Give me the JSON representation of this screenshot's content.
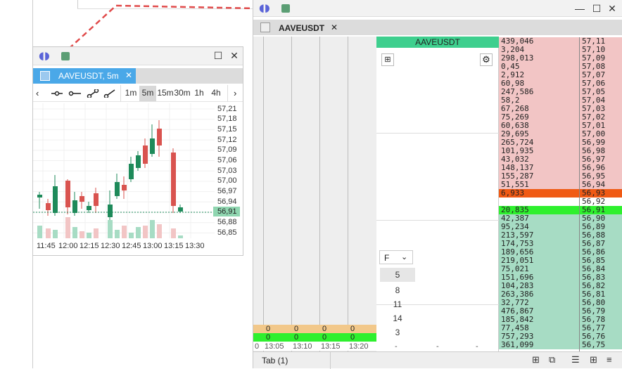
{
  "left_window": {
    "tab_title": "AAVEUSDT, 5m",
    "timeframes": [
      "1m",
      "5m",
      "15m",
      "30m",
      "1h",
      "4h"
    ],
    "selected_timeframe": "5m",
    "current_price": "56,91",
    "y_labels": [
      "57,21",
      "57,18",
      "57,15",
      "57,12",
      "57,09",
      "57,06",
      "57,03",
      "57,00",
      "56,97",
      "56,94",
      "56,91",
      "56,88",
      "56,85"
    ],
    "x_labels": [
      "11:45",
      "12:00",
      "12:15",
      "12:30",
      "12:45",
      "13:00",
      "13:15",
      "13:30"
    ]
  },
  "right_window": {
    "tab_title": "AAVEUSDT",
    "symbol_header": "AAVEUSDT",
    "filter_label": "F",
    "filter_options": [
      "5",
      "8",
      "11",
      "14",
      "3"
    ],
    "selected_filter": "5",
    "bottom_tab": "Tab (1)",
    "column_times": [
      "13:05",
      "13:10",
      "13:15",
      "13:20"
    ],
    "column_first": "0",
    "row_zeros_orange": [
      "0",
      "0",
      "0",
      "0"
    ],
    "row_zeros_green": [
      "0",
      "0",
      "0",
      "0"
    ],
    "dash": "-",
    "orderbook": [
      {
        "v": "439,046",
        "p": "57,11",
        "s": "ask"
      },
      {
        "v": "3,204",
        "p": "57,10",
        "s": "ask"
      },
      {
        "v": "298,013",
        "p": "57,09",
        "s": "ask"
      },
      {
        "v": "0,45",
        "p": "57,08",
        "s": "ask"
      },
      {
        "v": "2,912",
        "p": "57,07",
        "s": "ask"
      },
      {
        "v": "60,98",
        "p": "57,06",
        "s": "ask"
      },
      {
        "v": "247,586",
        "p": "57,05",
        "s": "ask"
      },
      {
        "v": "58,2",
        "p": "57,04",
        "s": "ask"
      },
      {
        "v": "67,268",
        "p": "57,03",
        "s": "ask"
      },
      {
        "v": "75,269",
        "p": "57,02",
        "s": "ask"
      },
      {
        "v": "60,638",
        "p": "57,01",
        "s": "ask"
      },
      {
        "v": "29,695",
        "p": "57,00",
        "s": "ask"
      },
      {
        "v": "265,724",
        "p": "56,99",
        "s": "ask"
      },
      {
        "v": "101,935",
        "p": "56,98",
        "s": "ask"
      },
      {
        "v": "43,032",
        "p": "56,97",
        "s": "ask"
      },
      {
        "v": "148,137",
        "p": "56,96",
        "s": "ask"
      },
      {
        "v": "155,287",
        "p": "56,95",
        "s": "ask"
      },
      {
        "v": "51,551",
        "p": "56,94",
        "s": "ask"
      },
      {
        "v": "6,933",
        "p": "56,93",
        "s": "bestask"
      },
      {
        "v": "",
        "p": "56,92",
        "s": "empty"
      },
      {
        "v": "20,835",
        "p": "56,91",
        "s": "bestbid"
      },
      {
        "v": "42,387",
        "p": "56,90",
        "s": "bid"
      },
      {
        "v": "95,234",
        "p": "56,89",
        "s": "bid"
      },
      {
        "v": "213,597",
        "p": "56,88",
        "s": "bid"
      },
      {
        "v": "174,753",
        "p": "56,87",
        "s": "bid"
      },
      {
        "v": "189,656",
        "p": "56,86",
        "s": "bid"
      },
      {
        "v": "219,051",
        "p": "56,85",
        "s": "bid"
      },
      {
        "v": "75,021",
        "p": "56,84",
        "s": "bid"
      },
      {
        "v": "151,696",
        "p": "56,83",
        "s": "bid"
      },
      {
        "v": "104,283",
        "p": "56,82",
        "s": "bid"
      },
      {
        "v": "263,386",
        "p": "56,81",
        "s": "bid"
      },
      {
        "v": "32,772",
        "p": "56,80",
        "s": "bid"
      },
      {
        "v": "476,867",
        "p": "56,79",
        "s": "bid"
      },
      {
        "v": "185,842",
        "p": "56,78",
        "s": "bid"
      },
      {
        "v": "77,458",
        "p": "56,77",
        "s": "bid"
      },
      {
        "v": "757,293",
        "p": "56,76",
        "s": "bid"
      },
      {
        "v": "361,099",
        "p": "56,75",
        "s": "bid"
      }
    ]
  },
  "colors": {
    "up": "#1e8a5a",
    "down": "#d9534f",
    "ask_bg": "#f2c5c5",
    "bid_bg": "#a7dcc4",
    "best_ask": "#f05a14",
    "best_bid": "#2ef02e",
    "accent_tab": "#4aa8e8",
    "header_green": "#3ecf8e"
  }
}
